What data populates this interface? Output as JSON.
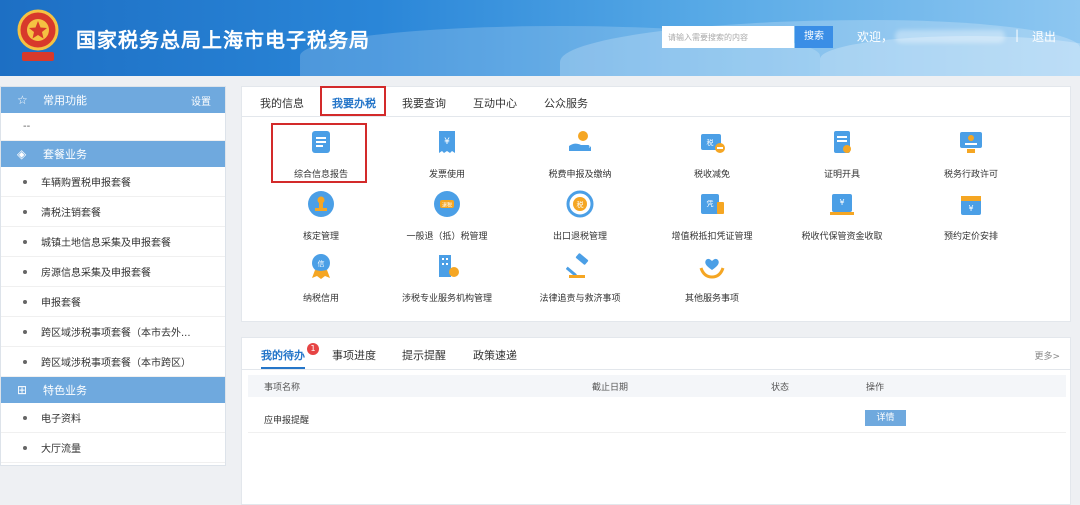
{
  "header": {
    "title": "国家税务总局上海市电子税务局",
    "search_placeholder": "请输入需要搜索的内容",
    "search_button": "搜索",
    "welcome": "欢迎，",
    "separator": "|",
    "logout": "退出"
  },
  "sidebar": {
    "common": {
      "label": "常用功能",
      "setting": "设置",
      "placeholder_item": "--"
    },
    "package": {
      "label": "套餐业务",
      "items": [
        "车辆购置税申报套餐",
        "清税注销套餐",
        "城镇土地信息采集及申报套餐",
        "房源信息采集及申报套餐",
        "申报套餐",
        "跨区域涉税事项套餐（本市去外...",
        "跨区域涉税事项套餐（本市跨区）"
      ]
    },
    "special": {
      "label": "特色业务",
      "items": [
        "电子资料",
        "大厅流量"
      ]
    }
  },
  "main_tabs": [
    "我的信息",
    "我要办税",
    "我要查询",
    "互动中心",
    "公众服务"
  ],
  "active_tab": "我要办税",
  "services": [
    {
      "label": "综合信息报告",
      "icon": "document-report-icon"
    },
    {
      "label": "发票使用",
      "icon": "invoice-icon"
    },
    {
      "label": "税费申报及缴纳",
      "icon": "payment-hand-icon"
    },
    {
      "label": "税收减免",
      "icon": "tax-reduction-icon"
    },
    {
      "label": "证明开具",
      "icon": "certificate-icon"
    },
    {
      "label": "税务行政许可",
      "icon": "license-icon"
    },
    {
      "label": "核定管理",
      "icon": "stamp-icon"
    },
    {
      "label": "一般退（抵）税管理",
      "icon": "refund-icon"
    },
    {
      "label": "出口退税管理",
      "icon": "export-refund-icon"
    },
    {
      "label": "增值税抵扣凭证管理",
      "icon": "voucher-icon"
    },
    {
      "label": "税收代保管资金收取",
      "icon": "custody-fund-icon"
    },
    {
      "label": "预约定价安排",
      "icon": "calendar-price-icon"
    },
    {
      "label": "纳税信用",
      "icon": "credit-icon"
    },
    {
      "label": "涉税专业服务机构管理",
      "icon": "building-icon"
    },
    {
      "label": "法律追责与救济事项",
      "icon": "gavel-icon"
    },
    {
      "label": "其他服务事项",
      "icon": "heart-hands-icon"
    }
  ],
  "bottom_tabs": [
    "我的待办",
    "事项进度",
    "提示提醒",
    "政策速递"
  ],
  "todo_badge": "1",
  "more_link": "更多>",
  "table": {
    "headers": [
      "事项名称",
      "截止日期",
      "状态",
      "操作"
    ],
    "rows": [
      {
        "name": "应申报提醒",
        "action": "详情"
      }
    ]
  },
  "colors": {
    "accent": "#2576c9",
    "highlight": "#d32a2a",
    "sidebar_header": "#6fa9de"
  }
}
